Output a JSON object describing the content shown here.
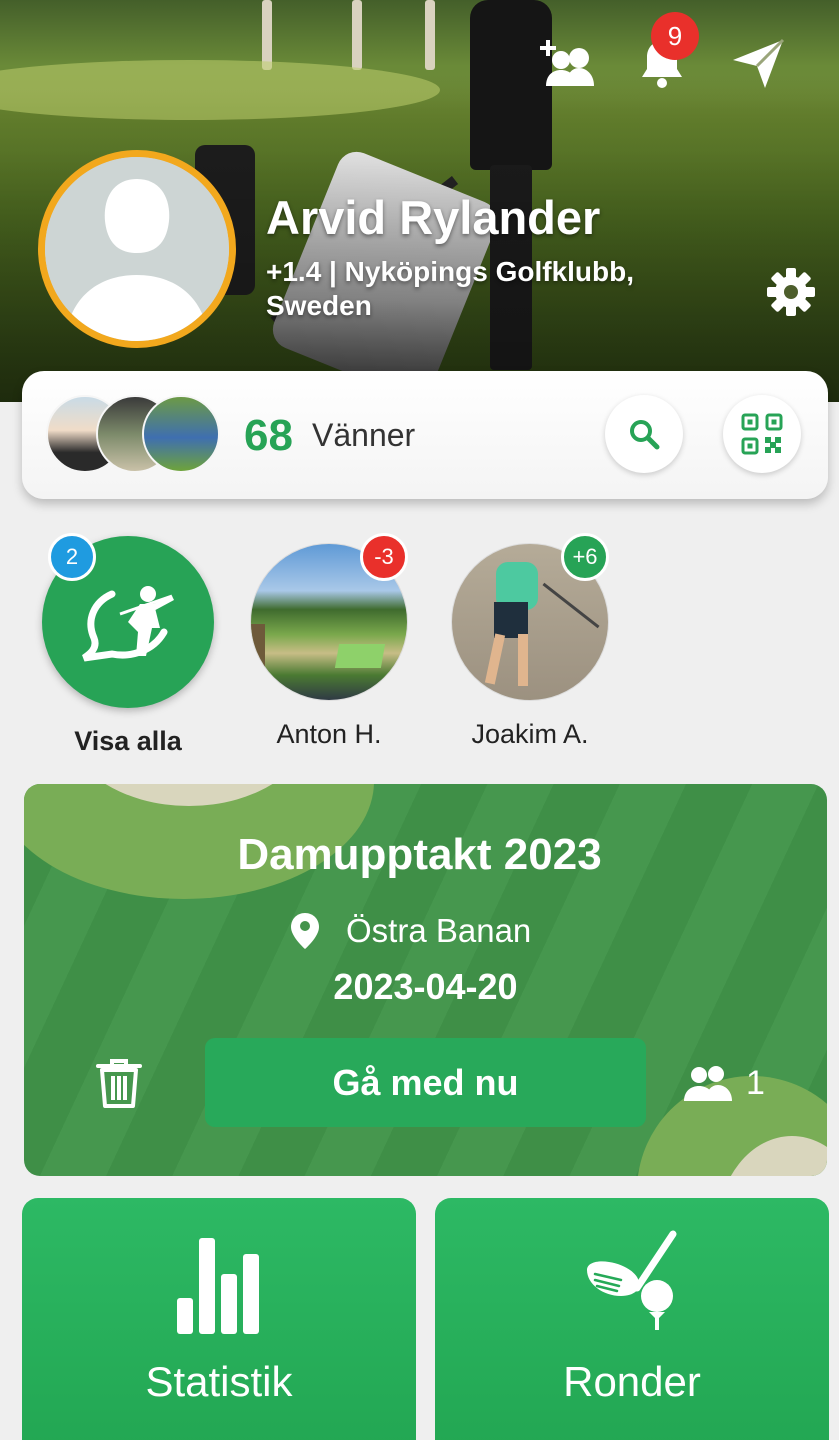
{
  "header": {
    "notifications_count": "9"
  },
  "profile": {
    "name": "Arvid Rylander",
    "subtitle": "+1.4 | Nyköpings Golfklubb, Sweden"
  },
  "friends": {
    "count": "68",
    "label": "Vänner"
  },
  "stories": [
    {
      "label": "Visa alla",
      "badge": "2",
      "badge_color": "#1f9be0"
    },
    {
      "label": "Anton H.",
      "badge": "-3",
      "badge_color": "#e9302b"
    },
    {
      "label": "Joakim  A.",
      "badge": "+6",
      "badge_color": "#27a356"
    }
  ],
  "event": {
    "title": "Damupptakt 2023",
    "location": "Östra Banan",
    "date": "2023-04-20",
    "join_label": "Gå med nu",
    "participants": "1"
  },
  "tiles": {
    "stats_label": "Statistik",
    "rounds_label": "Ronder"
  },
  "colors": {
    "accent_green": "#27a356",
    "avatar_ring": "#f2a81d",
    "badge_red": "#e9302b"
  },
  "icons": {
    "add_friend": "add-friend-icon",
    "bell": "bell-icon",
    "send": "send-icon",
    "settings": "gear-icon",
    "search": "search-icon",
    "qr": "qr-code-icon",
    "location": "location-pin-icon",
    "trash": "trash-icon",
    "people": "people-icon",
    "stats": "bar-chart-icon",
    "rounds": "golf-club-ball-icon"
  }
}
